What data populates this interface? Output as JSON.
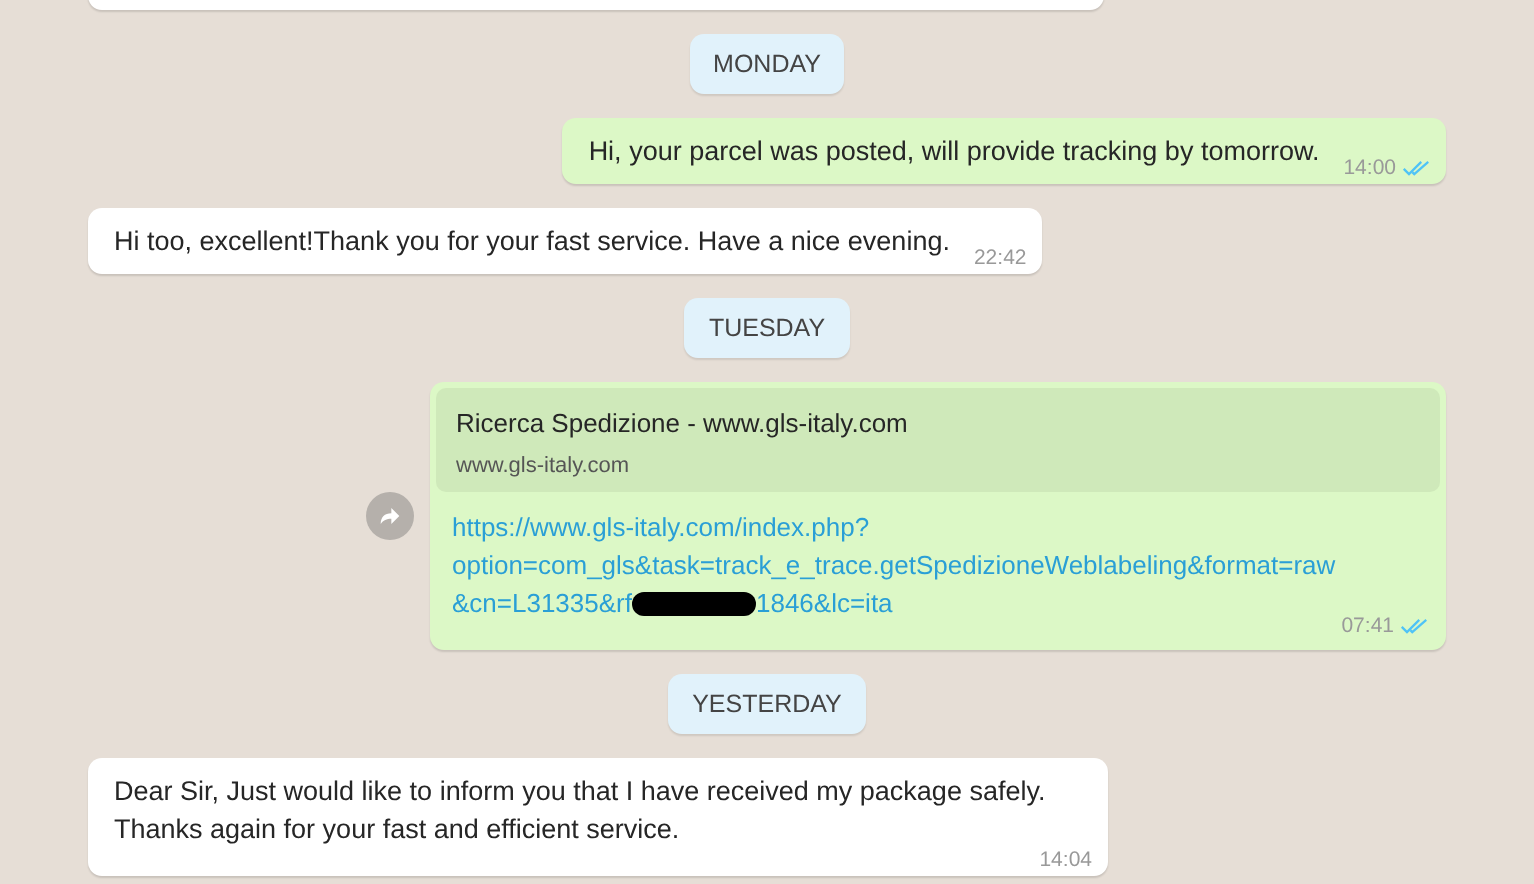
{
  "messages": [
    {
      "kind": "partial"
    },
    {
      "kind": "date",
      "text": "MONDAY"
    },
    {
      "kind": "outgoing",
      "text": "Hi, your parcel was posted, will provide tracking by tomorrow.",
      "time": "14:00",
      "read": true
    },
    {
      "kind": "incoming",
      "text": "Hi too, excellent!Thank you for your fast service. Have a nice evening.",
      "time": "22:42"
    },
    {
      "kind": "date",
      "text": "TUESDAY"
    },
    {
      "kind": "link",
      "preview_title": "Ricerca Spedizione - www.gls-italy.com",
      "preview_site": "www.gls-italy.com",
      "link_lines": [
        [
          "https://www.gls-italy.com/index.php?"
        ],
        [
          "option=com_gls&task=track_e_trace.getSpedizioneWeblabeling&format=raw"
        ],
        [
          "&cn=L31335&rf",
          "1846&lc=ita"
        ]
      ],
      "time": "07:41",
      "read": true
    },
    {
      "kind": "date",
      "text": "YESTERDAY"
    },
    {
      "kind": "incoming",
      "text": "Dear Sir, Just would like to inform you that I have received my package safely. Thanks again for your fast and efficient service.",
      "time": "14:04"
    }
  ]
}
